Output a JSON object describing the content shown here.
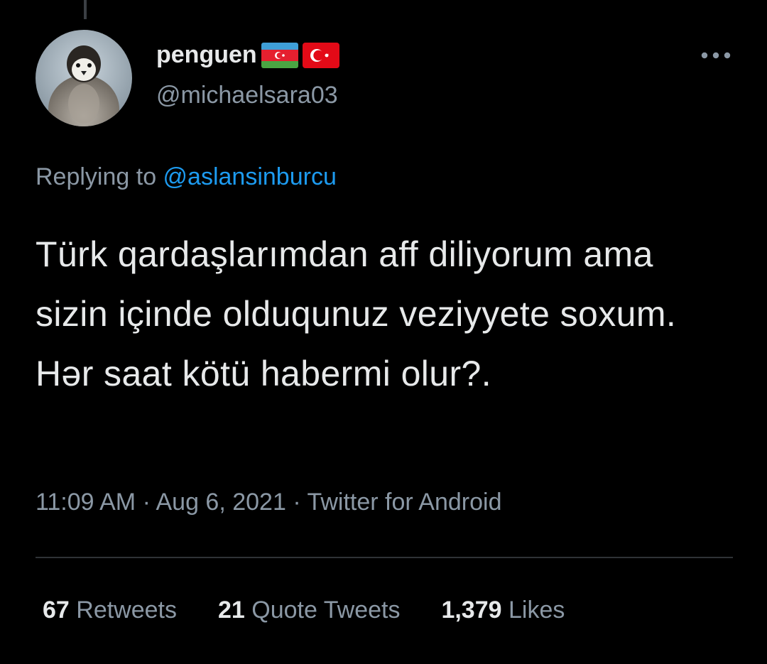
{
  "author": {
    "display_name": "penguen",
    "handle": "@michaelsara03",
    "flags": [
      "azerbaijan-flag",
      "turkey-flag"
    ],
    "avatar_icon": "penguin-avatar"
  },
  "reply": {
    "prefix": "Replying to ",
    "mention": "@aslansinburcu"
  },
  "tweet": {
    "text": "Türk qardaşlarımdan aff diliyorum ama sizin içinde olduqunuz veziyyete soxum. Hər saat kötü habermi olur?."
  },
  "meta": {
    "time": "11:09 AM",
    "separator": " · ",
    "date": "Aug 6, 2021",
    "source": "Twitter for Android"
  },
  "stats": {
    "retweets_count": "67",
    "retweets_label": " Retweets",
    "quotes_count": "21",
    "quotes_label": " Quote Tweets",
    "likes_count": "1,379",
    "likes_label": " Likes"
  },
  "colors": {
    "background": "#000000",
    "text": "#e7e9ea",
    "secondary": "#8b98a5",
    "link": "#1d9bf0",
    "divider": "#2f3336"
  }
}
